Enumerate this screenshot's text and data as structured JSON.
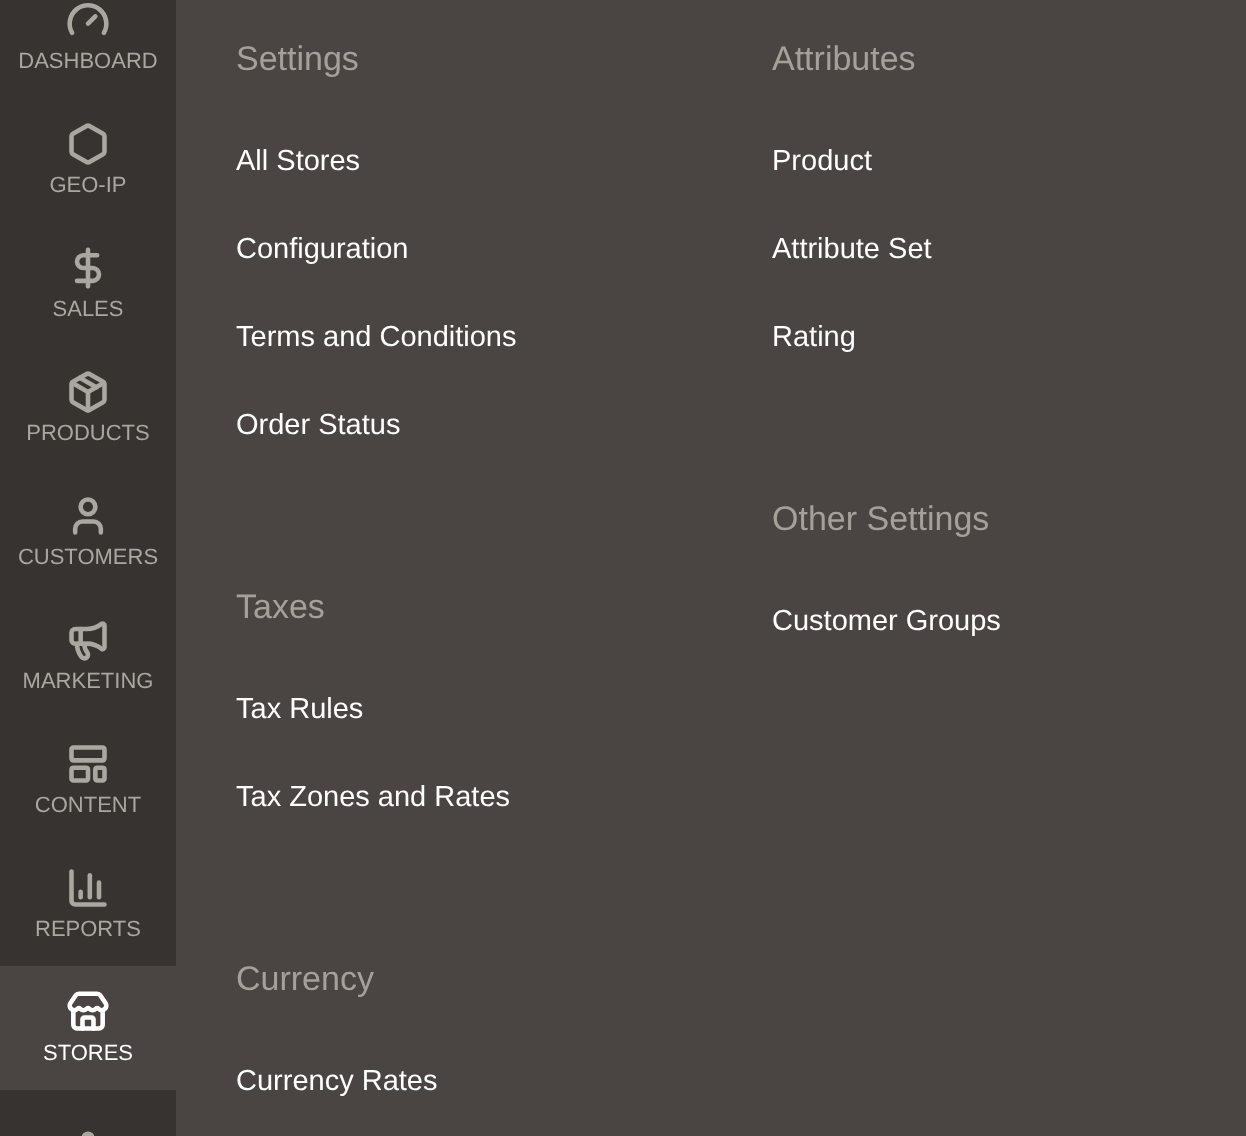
{
  "sidebar": {
    "items": [
      {
        "label": "DASHBOARD",
        "selected": false
      },
      {
        "label": "GEO-IP",
        "selected": false
      },
      {
        "label": "SALES",
        "selected": false
      },
      {
        "label": "PRODUCTS",
        "selected": false
      },
      {
        "label": "CUSTOMERS",
        "selected": false
      },
      {
        "label": "MARKETING",
        "selected": false
      },
      {
        "label": "CONTENT",
        "selected": false
      },
      {
        "label": "REPORTS",
        "selected": false
      },
      {
        "label": "STORES",
        "selected": true
      },
      {
        "selected": false
      }
    ]
  },
  "columns": [
    [
      {
        "title": "Settings",
        "links": [
          "All Stores",
          "Configuration",
          "Terms and Conditions",
          "Order Status"
        ]
      },
      {
        "title": "Taxes",
        "links": [
          "Tax Rules",
          "Tax Zones and Rates"
        ]
      },
      {
        "title": "Currency",
        "links": [
          "Currency Rates"
        ]
      }
    ],
    [
      {
        "title": "Attributes",
        "links": [
          "Product",
          "Attribute Set",
          "Rating"
        ]
      },
      {
        "title": "Other Settings",
        "links": [
          "Customer Groups"
        ]
      }
    ]
  ]
}
